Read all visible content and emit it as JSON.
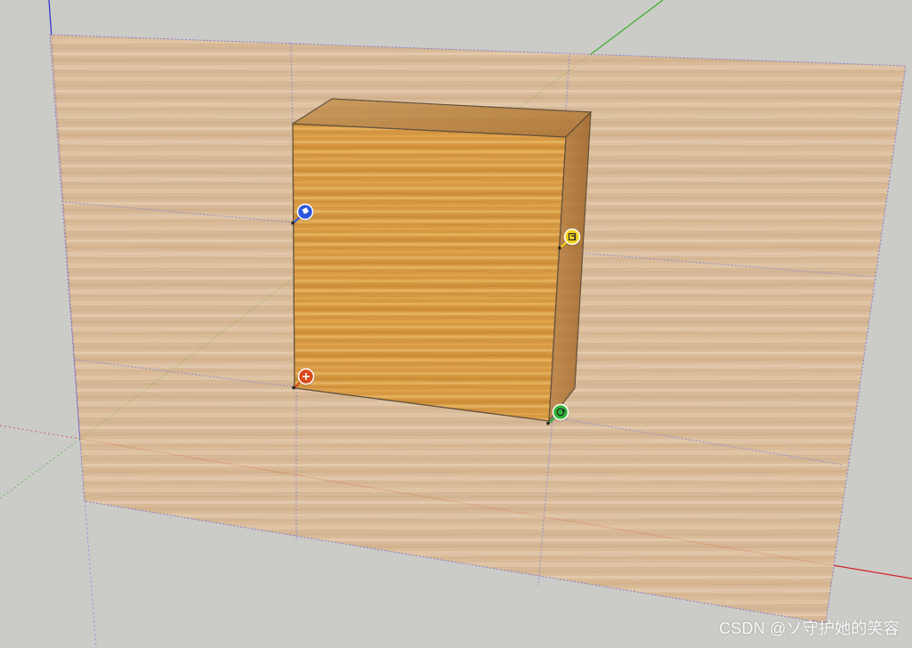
{
  "app": {
    "viewport_background": "#cbcbc8"
  },
  "scene": {
    "axes": {
      "blue_axis_color": "#2b2bd6",
      "green_axis_color": "#3caf2a",
      "red_axis_color": "#d21f1f"
    },
    "materials": {
      "wall_texture": "light-bamboo-wood-translucent",
      "box_texture": "bamboo-wood"
    },
    "gizmos": [
      {
        "name": "blue-pin-gizmo",
        "icon": "diamond-glyph",
        "color": "#2e57dd"
      },
      {
        "name": "yellow-pin-gizmo",
        "icon": "scale-glyph",
        "color": "#f3d21e"
      },
      {
        "name": "red-pin-gizmo",
        "icon": "move-plus-glyph",
        "color": "#d9481f"
      },
      {
        "name": "green-pin-gizmo",
        "icon": "rotate-glyph",
        "color": "#31b339"
      }
    ]
  },
  "watermark": {
    "text": "CSDN @ソ守护她的笑容"
  }
}
